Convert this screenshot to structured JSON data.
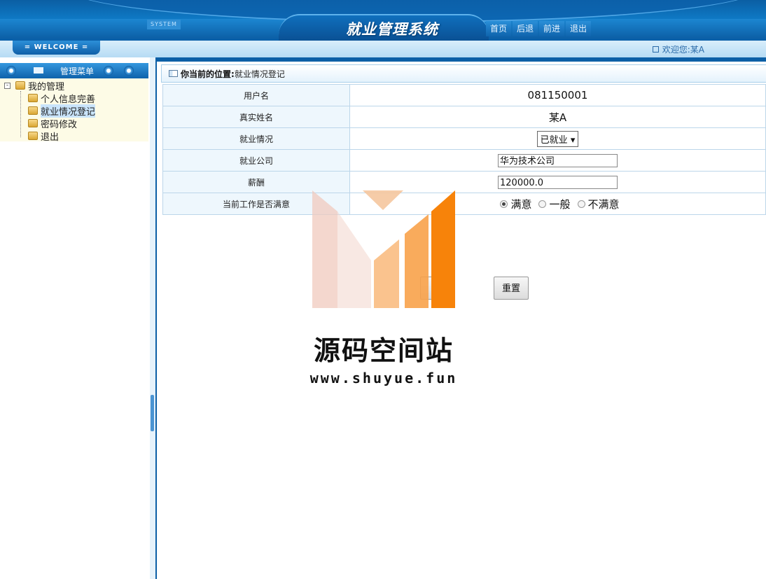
{
  "header": {
    "system_tag": "SYSTEM",
    "title": "就业管理系统",
    "nav": [
      "首页",
      "后退",
      "前进",
      "退出"
    ]
  },
  "welcome": {
    "tab": "= WELCOME =",
    "greeting": "欢迎您:某A"
  },
  "sidebar": {
    "menu_title": "管理菜单",
    "root": "我的管理",
    "items": [
      "个人信息完善",
      "就业情况登记",
      "密码修改",
      "退出"
    ],
    "selected_index": 1
  },
  "breadcrumb": {
    "label": "你当前的位置:",
    "value": "就业情况登记"
  },
  "form": {
    "rows": [
      {
        "label": "用户名",
        "value": "081150001"
      },
      {
        "label": "真实姓名",
        "value": "某A"
      },
      {
        "label": "就业情况",
        "value": "已就业"
      },
      {
        "label": "就业公司",
        "value": "华为技术公司"
      },
      {
        "label": "薪酬",
        "value": "120000.0"
      },
      {
        "label": "当前工作是否满意",
        "options": [
          "满意",
          "一般",
          "不满意"
        ],
        "selected": "满意"
      }
    ],
    "submit_label": "提",
    "reset_label": "重置"
  },
  "watermark": {
    "text": "源码空间站",
    "url": "www.shuyue.fun"
  },
  "colors": {
    "primary_blue": "#0c5fa6",
    "header_blue": "#0e78c4",
    "tree_bg": "#fdfbe6",
    "label_cell_bg": "#eef7fd",
    "watermark_orange": "#f7830a"
  }
}
